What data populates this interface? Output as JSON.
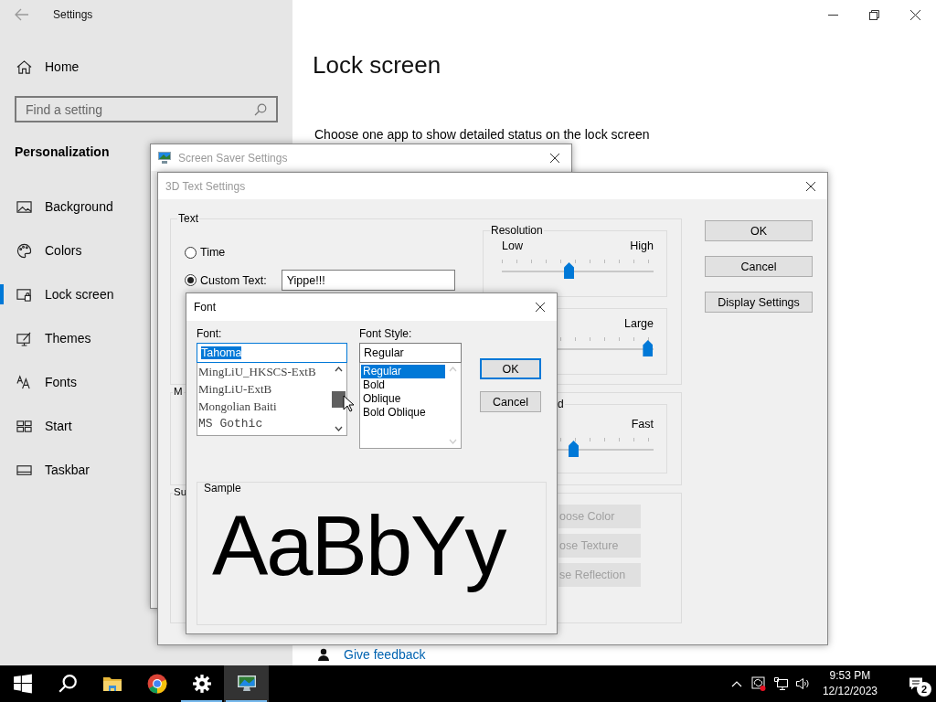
{
  "settings": {
    "title": "Settings",
    "home": "Home",
    "search": {
      "placeholder": "Find a setting"
    },
    "section": "Personalization",
    "nav": [
      {
        "label": "Background",
        "kind": "picture",
        "selected": false
      },
      {
        "label": "Colors",
        "kind": "palette",
        "selected": false
      },
      {
        "label": "Lock screen",
        "kind": "lock",
        "selected": true
      },
      {
        "label": "Themes",
        "kind": "themes",
        "selected": false
      },
      {
        "label": "Fonts",
        "kind": "fonts",
        "selected": false
      },
      {
        "label": "Start",
        "kind": "start",
        "selected": false
      },
      {
        "label": "Taskbar",
        "kind": "taskbar",
        "selected": false
      }
    ]
  },
  "page": {
    "heading": "Lock screen",
    "description": "Choose one app to show detailed status on the lock screen",
    "feedback_link": "Give feedback"
  },
  "screen_saver_window": {
    "title": "Screen Saver Settings"
  },
  "text_settings_window": {
    "title": "3D Text Settings",
    "text_group": {
      "label": "Text",
      "options": [
        {
          "label": "Time",
          "selected": false
        },
        {
          "label": "Custom Text:",
          "selected": true
        }
      ],
      "custom_text": "Yippe!!!"
    },
    "resolution": {
      "label": "Resolution",
      "min_label": "Low",
      "max_label": "High",
      "level": 0.44
    },
    "size": {
      "max_label": "Large",
      "level": 0.96
    },
    "motion": {
      "label": "M",
      "speed_label": "d",
      "max_label": "Fast",
      "level": 0.47
    },
    "surface": {
      "label": "Su",
      "buttons": [
        {
          "label": "oose Color",
          "disabled": true
        },
        {
          "label": "ose Texture",
          "disabled": true
        },
        {
          "label": "se Reflection",
          "disabled": true
        }
      ]
    },
    "buttons": [
      "OK",
      "Cancel",
      "Display Settings"
    ]
  },
  "font_dialog": {
    "title": "Font",
    "font_label": "Font:",
    "font_input": {
      "value": "Tahoma",
      "highlighted": true
    },
    "fonts": [
      {
        "label": "MingLiU_HKSCS-ExtB",
        "kind": "serif",
        "selected": false
      },
      {
        "label": "MingLiU-ExtB",
        "kind": "serif",
        "selected": false
      },
      {
        "label": "Mongolian Baiti",
        "kind": "serif",
        "selected": false
      },
      {
        "label": "MS Gothic",
        "kind": "mono",
        "selected": false
      }
    ],
    "style_label": "Font Style:",
    "style_input": {
      "value": "Regular"
    },
    "styles": [
      {
        "label": "Regular",
        "selected": true
      },
      {
        "label": "Bold",
        "selected": false
      },
      {
        "label": "Oblique",
        "selected": false
      },
      {
        "label": "Bold Oblique",
        "selected": false
      }
    ],
    "buttons": [
      {
        "label": "OK",
        "focused": true
      },
      {
        "label": "Cancel",
        "focused": false
      }
    ],
    "sample_label": "Sample",
    "sample_text": "AaBbYy"
  },
  "taskbar": {
    "apps": [
      {
        "kind": "start",
        "running": false,
        "active": false
      },
      {
        "kind": "search",
        "running": false,
        "active": false
      },
      {
        "kind": "folder",
        "running": false,
        "active": false
      },
      {
        "kind": "browser",
        "running": false,
        "active": false
      },
      {
        "kind": "gear",
        "running": true,
        "active": false
      },
      {
        "kind": "monitor",
        "running": true,
        "active": true
      }
    ],
    "time": "9:53 PM",
    "date": "12/12/2023",
    "notification_count": "2"
  }
}
